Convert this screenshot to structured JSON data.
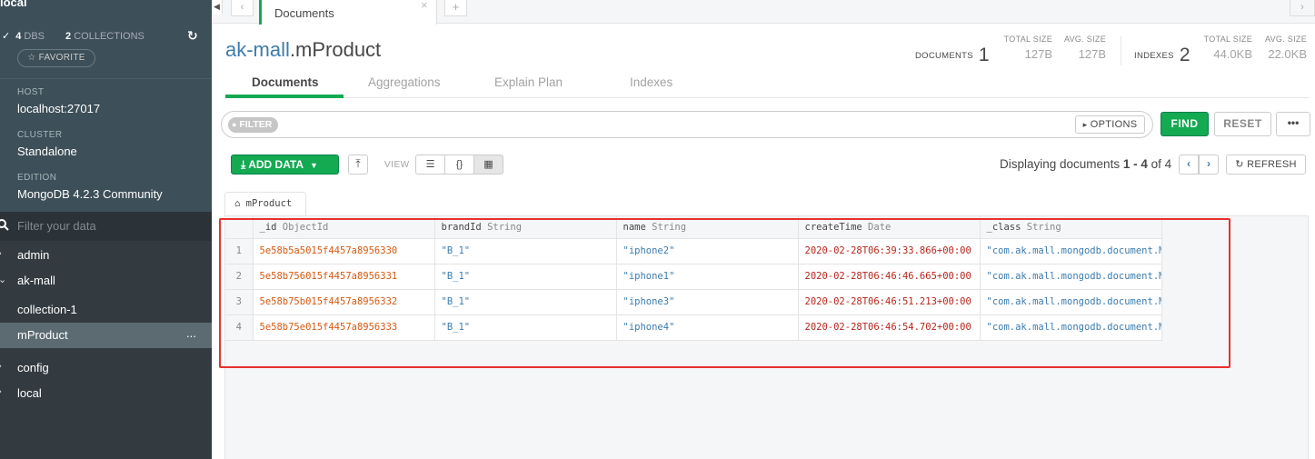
{
  "sidebar": {
    "instance_title": "local",
    "dbs_count": "4",
    "dbs_label": "DBS",
    "collections_count": "2",
    "collections_label": "COLLECTIONS",
    "favorite_label": "☆ FAVORITE",
    "host_label": "HOST",
    "host_value": "localhost:27017",
    "cluster_label": "CLUSTER",
    "cluster_value": "Standalone",
    "edition_label": "EDITION",
    "edition_value": "MongoDB 4.2.3 Community",
    "filter_placeholder": "Filter your data",
    "databases": [
      {
        "name": "admin"
      },
      {
        "name": "ak-mall"
      },
      {
        "name": "collection-1"
      },
      {
        "name": "mProduct",
        "more": "..."
      },
      {
        "name": "config"
      },
      {
        "name": "local"
      }
    ]
  },
  "tabbar": {
    "active_tab": "Documents",
    "add_symbol": "+",
    "close_symbol": "×"
  },
  "header": {
    "db_name": "ak-mall",
    "coll_name": ".mProduct",
    "documents_label": "DOCUMENTS",
    "documents_count": "1",
    "doc_total_size_label": "TOTAL SIZE",
    "doc_total_size": "127B",
    "doc_avg_size_label": "AVG. SIZE",
    "doc_avg_size": "127B",
    "indexes_label": "INDEXES",
    "indexes_count": "2",
    "idx_total_size_label": "TOTAL SIZE",
    "idx_total_size": "44.0KB",
    "idx_avg_size_label": "AVG. SIZE",
    "idx_avg_size": "22.0KB"
  },
  "subtabs": [
    "Documents",
    "Aggregations",
    "Explain Plan",
    "Indexes"
  ],
  "query": {
    "filter_label": "FILTER",
    "options_label": "OPTIONS",
    "find_label": "FIND",
    "reset_label": "RESET",
    "more_label": "•••"
  },
  "toolbar": {
    "add_data_label": "ADD DATA",
    "view_label": "VIEW",
    "displaying_prefix": "Displaying documents ",
    "range_start": "1",
    "range_sep": " - ",
    "range_end": "4",
    "of_text": " of ",
    "total": "4",
    "refresh_label": "REFRESH"
  },
  "grid": {
    "collection_tab": "mProduct",
    "columns": [
      {
        "name": "_id",
        "type": "ObjectId"
      },
      {
        "name": "brandId",
        "type": "String"
      },
      {
        "name": "name",
        "type": "String"
      },
      {
        "name": "createTime",
        "type": "Date"
      },
      {
        "name": "_class",
        "type": "String"
      }
    ],
    "rows": [
      {
        "n": "1",
        "id": "5e58b5a5015f4457a8956330",
        "brandId": "\"B_1\"",
        "name": "\"iphone2\"",
        "createTime": "2020-02-28T06:39:33.866+00:00",
        "cls": "\"com.ak.mall.mongodb.document.M"
      },
      {
        "n": "2",
        "id": "5e58b756015f4457a8956331",
        "brandId": "\"B_1\"",
        "name": "\"iphone1\"",
        "createTime": "2020-02-28T06:46:46.665+00:00",
        "cls": "\"com.ak.mall.mongodb.document.M"
      },
      {
        "n": "3",
        "id": "5e58b75b015f4457a8956332",
        "brandId": "\"B_1\"",
        "name": "\"iphone3\"",
        "createTime": "2020-02-28T06:46:51.213+00:00",
        "cls": "\"com.ak.mall.mongodb.document.M"
      },
      {
        "n": "4",
        "id": "5e58b75e015f4457a8956333",
        "brandId": "\"B_1\"",
        "name": "\"iphone4\"",
        "createTime": "2020-02-28T06:46:54.702+00:00",
        "cls": "\"com.ak.mall.mongodb.document.M"
      }
    ]
  },
  "colors": {
    "sidebar_bg": "#333b40",
    "accent_green": "#13aa52",
    "link_blue": "#3c7cae",
    "objectid_orange": "#d65911",
    "date_red": "#b7261c",
    "highlight_red": "#e8302d"
  }
}
